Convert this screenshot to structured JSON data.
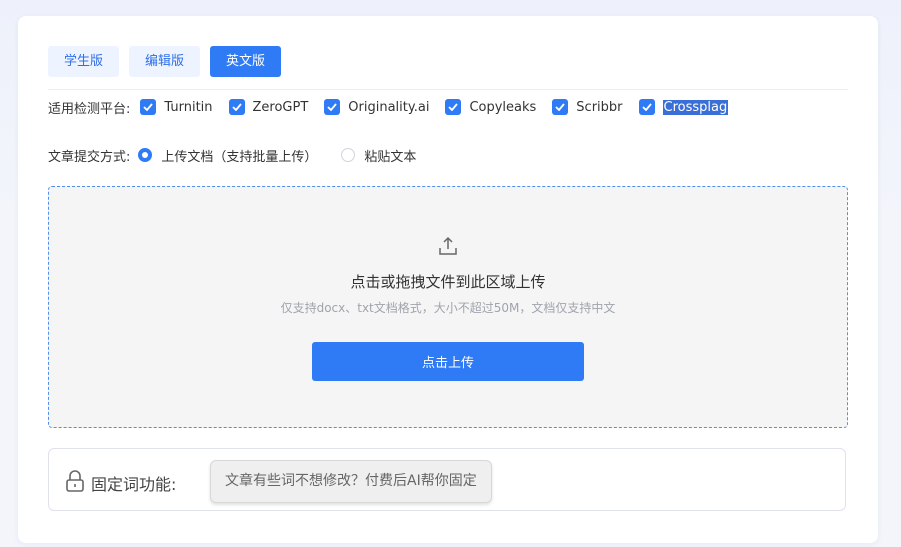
{
  "tabs": [
    {
      "label": "学生版",
      "active": false
    },
    {
      "label": "编辑版",
      "active": false
    },
    {
      "label": "英文版",
      "active": true
    }
  ],
  "platforms": {
    "label": "适用检测平台:",
    "items": [
      {
        "label": "Turnitin",
        "checked": true
      },
      {
        "label": "ZeroGPT",
        "checked": true
      },
      {
        "label": "Originality.ai",
        "checked": true
      },
      {
        "label": "Copyleaks",
        "checked": true
      },
      {
        "label": "Scribbr",
        "checked": true
      },
      {
        "label": "Crossplag",
        "checked": true
      }
    ]
  },
  "submit_method": {
    "label": "文章提交方式:",
    "options": [
      {
        "label": "上传文档（支持批量上传）",
        "selected": true
      },
      {
        "label": "粘贴文本",
        "selected": false
      }
    ]
  },
  "upload": {
    "icon": "upload-icon",
    "title": "点击或拖拽文件到此区域上传",
    "hint": "仅支持docx、txt文档格式，大小不超过50M，文档仅支持中文",
    "button_label": "点击上传"
  },
  "fixed_words": {
    "icon": "lock-icon",
    "label": "固定词功能:",
    "button_label": "文章有些词不想修改？付费后AI帮你固定"
  },
  "colors": {
    "accent": "#2f7bf6",
    "tab_inactive_bg": "#eef4ff",
    "upload_border": "#4f8ff2"
  }
}
